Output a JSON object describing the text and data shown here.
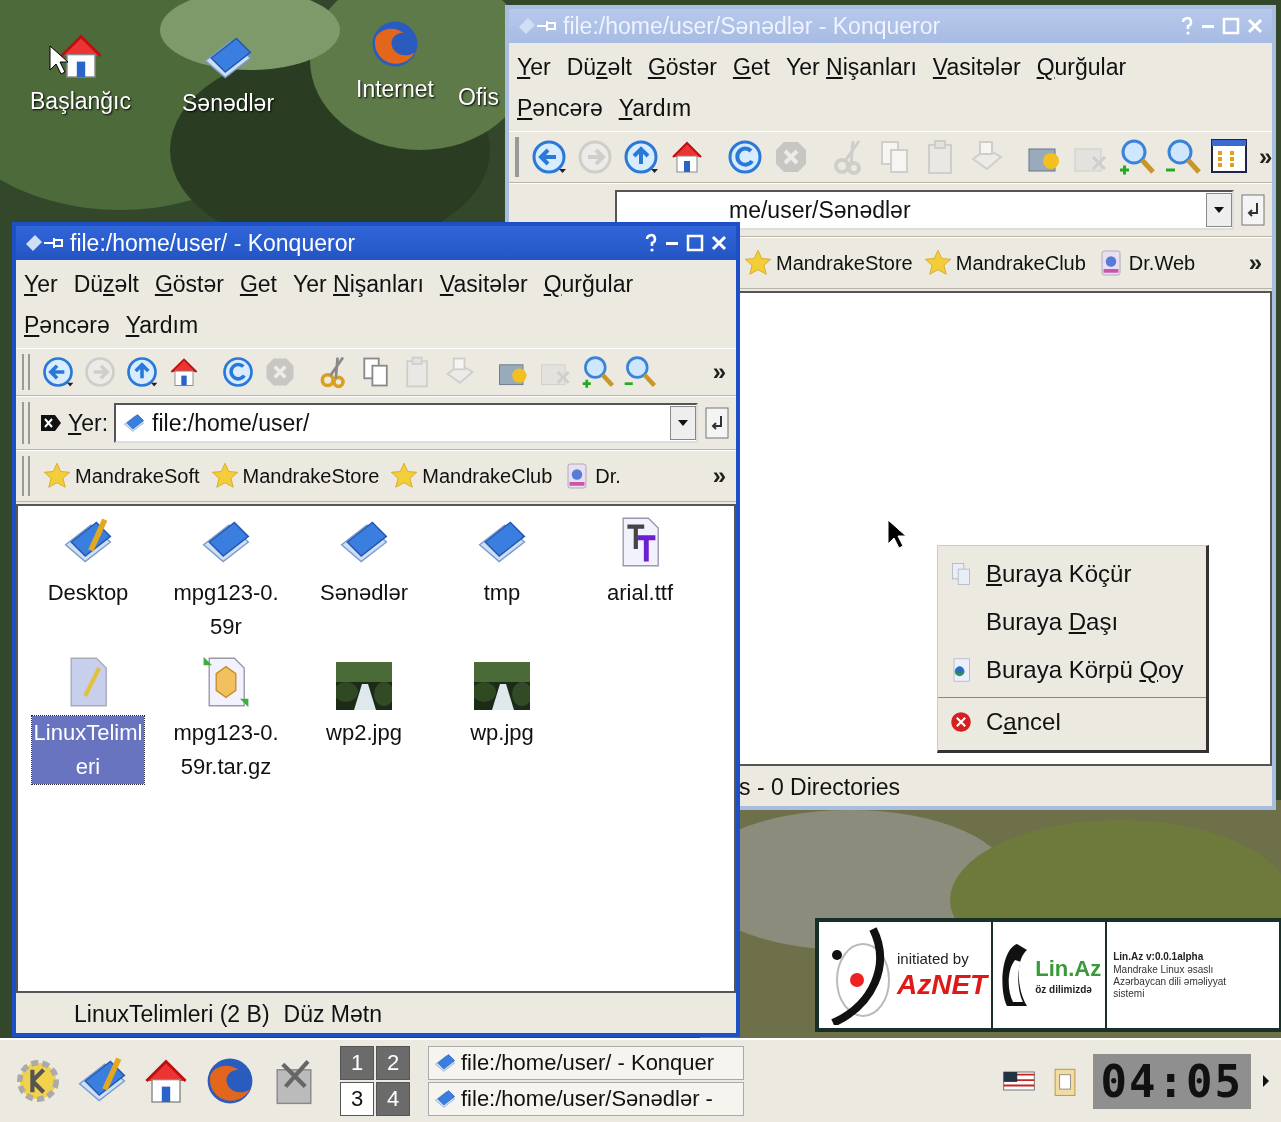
{
  "desktop_icons": [
    {
      "label": "Başlanğıc",
      "kind": "home"
    },
    {
      "label": "Sənədlər",
      "kind": "folder"
    },
    {
      "label": "Internet",
      "kind": "browser"
    },
    {
      "label": "Ofis",
      "kind": "hidden"
    }
  ],
  "windows": [
    {
      "title": "file:/home/user/Sənədlər - Konqueror",
      "active": false,
      "menu_rows": [
        [
          {
            "key": "Y",
            "post": "er"
          },
          {
            "pre": "Dü",
            "key": "z",
            "post": "əlt"
          },
          {
            "key": "G",
            "post": "östər"
          },
          {
            "key": "G",
            "post": "et"
          },
          {
            "pre": "Yer ",
            "key": "N",
            "post": "işanları"
          },
          {
            "key": "V",
            "post": "asitələr"
          },
          {
            "key": "Q",
            "post": "urğular"
          }
        ],
        [
          {
            "key": "P",
            "post": "əncərə"
          },
          {
            "key": "Y",
            "post": "ardım"
          }
        ]
      ],
      "toolbar": [
        {
          "kind": "back",
          "disabled": false
        },
        {
          "kind": "forward",
          "disabled": true
        },
        {
          "kind": "up",
          "disabled": false
        },
        {
          "kind": "home",
          "disabled": false
        },
        {
          "kind": "reload",
          "disabled": false
        },
        {
          "kind": "stop",
          "disabled": true
        },
        {
          "kind": "cut",
          "disabled": true
        },
        {
          "kind": "copy",
          "disabled": true
        },
        {
          "kind": "paste",
          "disabled": true
        },
        {
          "kind": "print",
          "disabled": true
        },
        {
          "kind": "newfolder",
          "disabled": false
        },
        {
          "kind": "trash",
          "disabled": true
        },
        {
          "kind": "zoomin",
          "disabled": false
        },
        {
          "kind": "zoomout",
          "disabled": false
        },
        {
          "kind": "view",
          "disabled": false
        }
      ],
      "toolbar_more": "»",
      "location": {
        "value": "me/user/Sənədlər"
      },
      "bookmarks": [
        {
          "label": "MandrakeStore",
          "kind": "star"
        },
        {
          "label": "MandrakeClub",
          "kind": "star"
        },
        {
          "label": "Dr.Web",
          "kind": "web"
        }
      ],
      "bookmarks_more": "»",
      "status": [
        "s - 0 Directories"
      ]
    },
    {
      "title": "file:/home/user/ - Konqueror",
      "active": true,
      "menu_rows": [
        [
          {
            "key": "Y",
            "post": "er"
          },
          {
            "pre": "Dü",
            "key": "z",
            "post": "əlt"
          },
          {
            "key": "G",
            "post": "östər"
          },
          {
            "key": "G",
            "post": "et"
          },
          {
            "pre": "Yer ",
            "key": "N",
            "post": "işanları"
          },
          {
            "key": "V",
            "post": "asitələr"
          },
          {
            "key": "Q",
            "post": "urğular"
          }
        ],
        [
          {
            "key": "P",
            "post": "əncərə"
          },
          {
            "key": "Y",
            "post": "ardım"
          }
        ]
      ],
      "toolbar": [
        {
          "kind": "back",
          "disabled": false
        },
        {
          "kind": "forward",
          "disabled": true
        },
        {
          "kind": "up",
          "disabled": false
        },
        {
          "kind": "home",
          "disabled": false
        },
        {
          "kind": "reload",
          "disabled": false
        },
        {
          "kind": "stop",
          "disabled": true
        },
        {
          "kind": "cut",
          "disabled": false
        },
        {
          "kind": "copy",
          "disabled": false
        },
        {
          "kind": "paste",
          "disabled": true
        },
        {
          "kind": "print",
          "disabled": true
        },
        {
          "kind": "newfolder",
          "disabled": false
        },
        {
          "kind": "trash",
          "disabled": true
        },
        {
          "kind": "zoomin",
          "disabled": false
        },
        {
          "kind": "zoomout",
          "disabled": false
        }
      ],
      "toolbar_more": "»",
      "location": {
        "label": {
          "key": "Y",
          "post": "er:"
        },
        "value": "file:/home/user/"
      },
      "bookmarks": [
        {
          "label": "MandrakeSoft",
          "kind": "star"
        },
        {
          "label": "MandrakeStore",
          "kind": "star"
        },
        {
          "label": "MandrakeClub",
          "kind": "star"
        },
        {
          "label": "Dr.",
          "kind": "web"
        }
      ],
      "bookmarks_more": "»",
      "files": [
        {
          "label": "Desktop",
          "kind": "desktop",
          "selected": false
        },
        {
          "label": "mpg123-0.59r",
          "kind": "folder",
          "selected": false
        },
        {
          "label": "Sənədlər",
          "kind": "folder",
          "selected": false
        },
        {
          "label": "tmp",
          "kind": "folder",
          "selected": false
        },
        {
          "label": "arial.ttf",
          "kind": "font",
          "selected": false
        },
        {
          "label": "LinuxTelimleri",
          "kind": "text",
          "selected": true
        },
        {
          "label": "mpg123-0.59r.tar.gz",
          "kind": "archive",
          "selected": false
        },
        {
          "label": "wp2.jpg",
          "kind": "picture",
          "selected": false
        },
        {
          "label": "wp.jpg",
          "kind": "picture",
          "selected": false
        }
      ],
      "status": [
        "LinuxTelimleri (2 B)",
        "Düz Mətn"
      ]
    }
  ],
  "context_menu": [
    {
      "label": {
        "key": "B",
        "post": "uraya Köçür"
      },
      "kind": "copy",
      "separator_before": false
    },
    {
      "label": {
        "pre": "Buraya ",
        "key": "D",
        "post": "aşı"
      },
      "kind": "none",
      "separator_before": false
    },
    {
      "label": {
        "pre": "Buraya Körpü ",
        "key": "Q",
        "post": "oy"
      },
      "kind": "link",
      "separator_before": false
    },
    {
      "label": {
        "pre": "C",
        "key": "a",
        "post": "ncel"
      },
      "kind": "cancel",
      "separator_before": true
    }
  ],
  "banner": {
    "initiated": "initiated by",
    "aznet": "AzNET",
    "linaz": "Lin.Az",
    "slogan": "öz dilimizdə",
    "version": "Lin.Az v:0.0.1alpha",
    "description": "Mandrake Linux əsaslı Azərbaycan dili əməliyyat sistemi"
  },
  "taskbar": {
    "launchers": [
      {
        "kind": "kmenu"
      },
      {
        "kind": "desktop"
      },
      {
        "kind": "home"
      },
      {
        "kind": "browser"
      },
      {
        "kind": "tools"
      }
    ],
    "pager": [
      {
        "label": "1",
        "selected": false
      },
      {
        "label": "2",
        "selected": false
      },
      {
        "label": "3",
        "selected": true
      },
      {
        "label": "4",
        "selected": false
      }
    ],
    "tasks": [
      {
        "label": "file:/home/user/ - Konquer"
      },
      {
        "label": "file:/home/user/Sənədlər -"
      }
    ],
    "tray": [
      {
        "kind": "flag"
      },
      {
        "kind": "clipboard"
      }
    ],
    "clock": "04:05"
  }
}
